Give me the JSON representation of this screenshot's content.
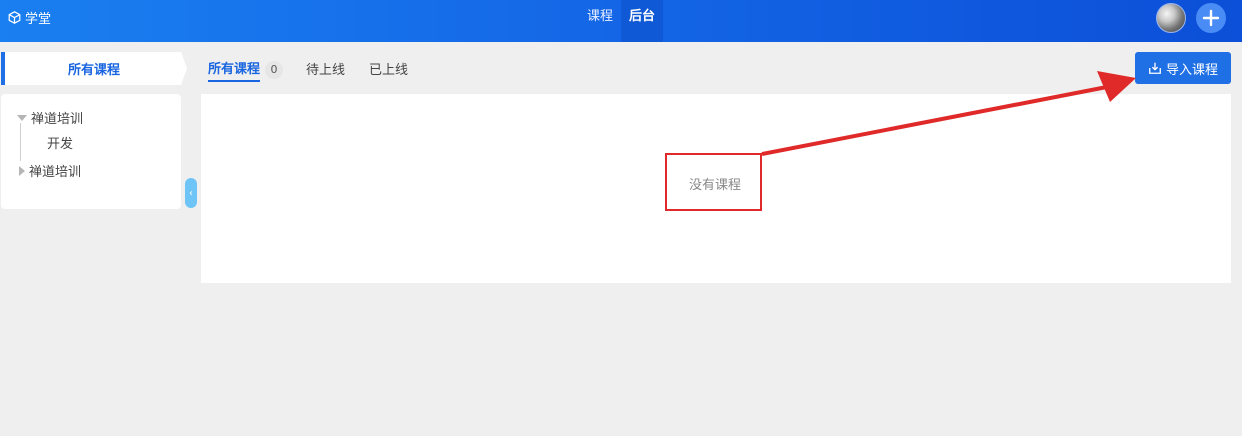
{
  "header": {
    "brand": "学堂",
    "nav": [
      {
        "label": "课程",
        "active": false
      },
      {
        "label": "后台",
        "active": true
      }
    ]
  },
  "sidebar": {
    "title": "所有课程",
    "tree": [
      {
        "label": "禅道培训",
        "expanded": true
      },
      {
        "label": "开发",
        "child": true
      },
      {
        "label": "禅道培训",
        "expanded": false
      }
    ],
    "collapse_glyph": "‹"
  },
  "tabs": [
    {
      "label": "所有课程",
      "count": "0",
      "active": true
    },
    {
      "label": "待上线",
      "active": false
    },
    {
      "label": "已上线",
      "active": false
    }
  ],
  "toolbar": {
    "import_label": "导入课程"
  },
  "content": {
    "empty_text": "没有课程"
  },
  "colors": {
    "primary": "#1f6fe5",
    "annotation": "#e02a2a"
  }
}
